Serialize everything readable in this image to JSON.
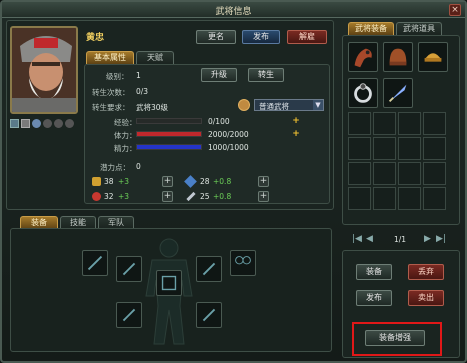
{
  "window": {
    "title": "武将信息"
  },
  "general": {
    "name": "黄忠"
  },
  "actions": {
    "rename": "更名",
    "publish": "发布",
    "dismiss": "解雇"
  },
  "tabs_top": [
    {
      "label": "基本属性"
    },
    {
      "label": "天赋"
    }
  ],
  "info": {
    "level_label": "级别：",
    "level_value": "1",
    "upgrade_button": "升级",
    "rebirth_button": "转生",
    "rebirth_count_label": "转生次数：",
    "rebirth_count_value": "0/3",
    "rebirth_req_label": "转生要求：",
    "rebirth_req_value": "武将30级",
    "rank_select": "普通武将"
  },
  "stats": {
    "exp_label": "经验：",
    "exp_value": "0/100",
    "exp_fraction": 0.0,
    "hp_label": "体力：",
    "hp_value": "2000/2000",
    "hp_fraction": 1.0,
    "mp_label": "精力：",
    "mp_value": "1000/1000",
    "mp_fraction": 1.0
  },
  "potential": {
    "label": "潜力点：",
    "value": "0"
  },
  "attributes": [
    {
      "value": "38",
      "bonus": "+3"
    },
    {
      "value": "28",
      "bonus": "+0.8"
    },
    {
      "value": "32",
      "bonus": "+3"
    },
    {
      "value": "25",
      "bonus": "+0.8"
    }
  ],
  "tabs_bottom": [
    {
      "label": "装备"
    },
    {
      "label": "技能"
    },
    {
      "label": "军队"
    }
  ],
  "right_tabs": [
    {
      "label": "武将装备"
    },
    {
      "label": "武将道具"
    }
  ],
  "pagination": {
    "label": "1/1"
  },
  "right_buttons": {
    "equip": "装备",
    "discard": "丢弃",
    "publish": "发布",
    "sell": "卖出",
    "enhance": "装备增强"
  },
  "colors": {
    "accent": "#a57a2a",
    "hp": "#c0282c",
    "mp": "#2434c8",
    "exp": "#c8c8c8",
    "highlight": "#e01818"
  }
}
